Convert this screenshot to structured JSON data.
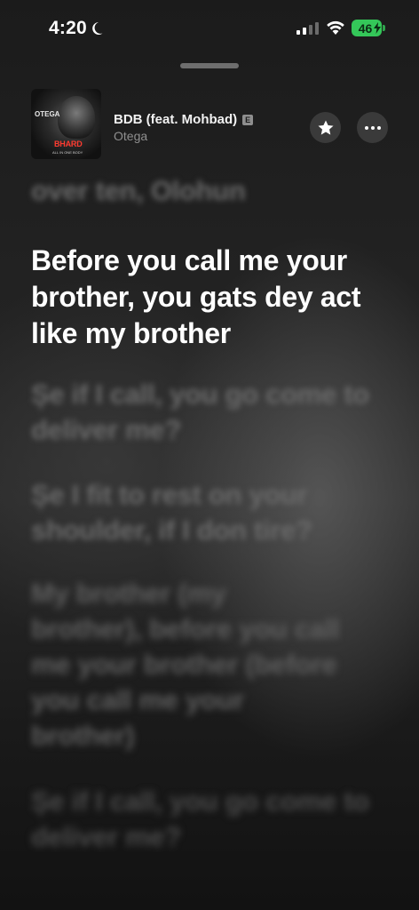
{
  "status_bar": {
    "time": "4:20",
    "battery": "46"
  },
  "track": {
    "title": "BDB (feat. Mohbad)",
    "explicit_badge": "E",
    "artist": "Otega",
    "artwork": {
      "artist_text": "OTEGA",
      "title_text": "BHARD",
      "subtitle_text": "ALL IN ONE BODY"
    }
  },
  "lyrics": {
    "previous": "over ten, Olohun",
    "current": "Before you call me your brother, you gats dey act like my brother",
    "upcoming": [
      "Șe if I call, you go come to deliver me?",
      "Șe I fit to rest on your shoulder, if I don tire?",
      "My brother (my brother), before you call me your brother (before you call me your brother)",
      "Șe if I call, you go come to deliver me?"
    ]
  },
  "icons": {
    "moon": "moon-icon",
    "signal": "cellular-signal-icon",
    "wifi": "wifi-icon",
    "battery": "battery-icon",
    "star": "star-icon",
    "more": "more-icon"
  },
  "colors": {
    "battery": "#34c759",
    "active_lyric": "#ffffff",
    "dim_lyric": "#6a6a6a"
  }
}
